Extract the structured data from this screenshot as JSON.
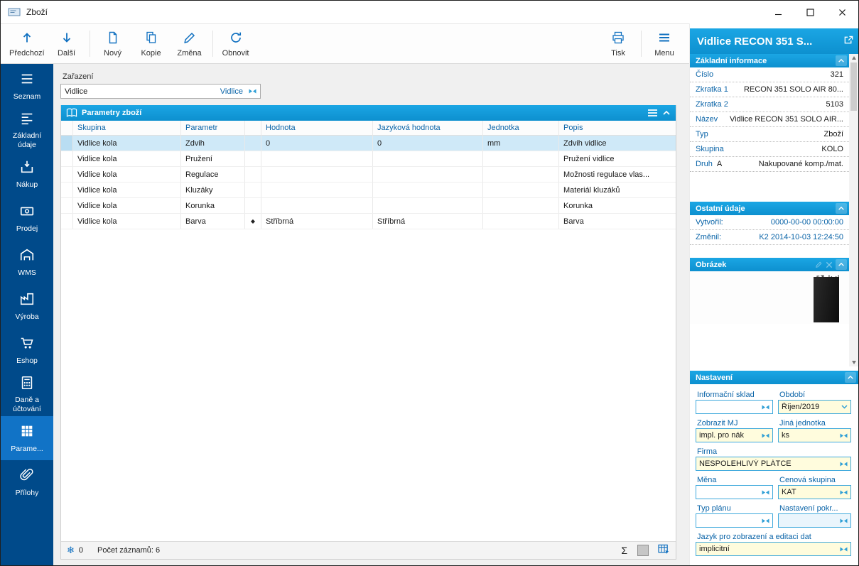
{
  "accent_colors": {
    "sidebar_blue": "#004a8a",
    "sidebar_active_blue": "#1173c6",
    "header_blue": "#0d96d4",
    "label_blue": "#0a64a8",
    "icon_blue": "#1070c0",
    "selected_row_blue": "#cfe9f8",
    "input_yellow": "#fffcdd",
    "input_border_blue": "#3fa9dc"
  },
  "window": {
    "title": "Zboží"
  },
  "toolbar": {
    "buttons": [
      {
        "label": "Předchozí",
        "icon": "arrow-up-icon"
      },
      {
        "label": "Další",
        "icon": "arrow-down-icon"
      },
      {
        "label": "Nový",
        "icon": "new-document-icon"
      },
      {
        "label": "Kopie",
        "icon": "copy-document-icon"
      },
      {
        "label": "Změna",
        "icon": "edit-pencil-icon"
      },
      {
        "label": "Obnovit",
        "icon": "refresh-icon"
      },
      {
        "label": "Tisk",
        "icon": "printer-icon"
      },
      {
        "label": "Menu",
        "icon": "hamburger-icon"
      }
    ]
  },
  "sidebar": {
    "items": [
      {
        "label": "Seznam",
        "icon": "list-icon",
        "active": false
      },
      {
        "label": "Základní údaje",
        "icon": "detail-list-icon",
        "active": false
      },
      {
        "label": "Nákup",
        "icon": "purchase-icon",
        "active": false
      },
      {
        "label": "Prodej",
        "icon": "sale-icon",
        "active": false
      },
      {
        "label": "WMS",
        "icon": "warehouse-icon",
        "active": false
      },
      {
        "label": "Výroba",
        "icon": "production-icon",
        "active": false
      },
      {
        "label": "Eshop",
        "icon": "cart-icon",
        "active": false
      },
      {
        "label": "Daně a účtování",
        "icon": "calculator-icon",
        "active": false
      },
      {
        "label": "Parame...",
        "icon": "parameters-grid-icon",
        "active": true
      },
      {
        "label": "Přílohy",
        "icon": "paperclip-icon",
        "active": false
      }
    ]
  },
  "main": {
    "zarazeni": {
      "label": "Zařazení",
      "value": "Vidlice",
      "link_value": "Vidlice"
    },
    "panel_title": "Parametry zboží",
    "table": {
      "columns": [
        "Skupina",
        "Parametr",
        "",
        "Hodnota",
        "Jazyková hodnota",
        "Jednotka",
        "Popis"
      ],
      "rows": [
        {
          "skupina": "Vidlice kola",
          "parametr": "Zdvih",
          "marker": "",
          "hodnota": "0",
          "jazykova_hodnota": "0",
          "jednotka": "mm",
          "popis": "Zdvih vidlice"
        },
        {
          "skupina": "Vidlice kola",
          "parametr": "Pružení",
          "marker": "",
          "hodnota": "",
          "jazykova_hodnota": "",
          "jednotka": "",
          "popis": "Pružení vidlice"
        },
        {
          "skupina": "Vidlice kola",
          "parametr": "Regulace",
          "marker": "",
          "hodnota": "",
          "jazykova_hodnota": "",
          "jednotka": "",
          "popis": "Možnosti regulace vlas..."
        },
        {
          "skupina": "Vidlice kola",
          "parametr": "Kluzáky",
          "marker": "",
          "hodnota": "",
          "jazykova_hodnota": "",
          "jednotka": "",
          "popis": "Materiál kluzáků"
        },
        {
          "skupina": "Vidlice kola",
          "parametr": "Korunka",
          "marker": "",
          "hodnota": "",
          "jazykova_hodnota": "",
          "jednotka": "",
          "popis": "Korunka"
        },
        {
          "skupina": "Vidlice kola",
          "parametr": "Barva",
          "marker": "◆",
          "hodnota": "Stříbrná",
          "jazykova_hodnota": "Stříbrná",
          "jednotka": "",
          "popis": "Barva"
        }
      ]
    },
    "statusbar": {
      "snowflake": "❄",
      "frozen_count": "0",
      "record_count_label": "Počet záznamů: 6",
      "sigma": "Σ"
    }
  },
  "right_panel": {
    "title": "Vidlice RECON 351 S...",
    "basic_info": {
      "title": "Základní informace",
      "fields": [
        {
          "label": "Číslo",
          "value": "321"
        },
        {
          "label": "Zkratka 1",
          "value": "RECON 351 SOLO AIR 80..."
        },
        {
          "label": "Zkratka 2",
          "value": "5103"
        },
        {
          "label": "Název",
          "value": "Vidlice RECON 351 SOLO AIR..."
        },
        {
          "label": "Typ",
          "value": "Zboží"
        },
        {
          "label": "Skupina",
          "value": "KOLO"
        },
        {
          "label": "Druh",
          "prefix": "A",
          "value": "Nakupované komp./mat."
        }
      ]
    },
    "other_info": {
      "title": "Ostatní údaje",
      "fields": [
        {
          "label": "Vytvořil:",
          "value": "0000-00-00 00:00:00"
        },
        {
          "label": "Změnil:",
          "value": "K2 2014-10-03 12:24:50"
        }
      ]
    },
    "image_section": {
      "title": "Obrázek"
    },
    "settings": {
      "title": "Nastavení",
      "fields": {
        "informacni_sklad": {
          "label": "Informační sklad",
          "value": ""
        },
        "obdobi": {
          "label": "Období",
          "value": "Říjen/2019"
        },
        "zobrazit_mj": {
          "label": "Zobrazit MJ",
          "value": "impl. pro nák"
        },
        "jina_jednotka": {
          "label": "Jiná jednotka",
          "value": "ks"
        },
        "firma": {
          "label": "Firma",
          "value": "NESPOLEHLIVÝ PLÁTCE"
        },
        "mena": {
          "label": "Měna",
          "value": ""
        },
        "cenova_skupina": {
          "label": "Cenová skupina",
          "value": "KAT"
        },
        "typ_planu": {
          "label": "Typ plánu",
          "value": ""
        },
        "nastaveni_pokr": {
          "label": "Nastavení pokr...",
          "value": ""
        },
        "jazyk": {
          "label": "Jazyk pro zobrazení a editaci dat",
          "value": "implicitní"
        }
      }
    }
  }
}
